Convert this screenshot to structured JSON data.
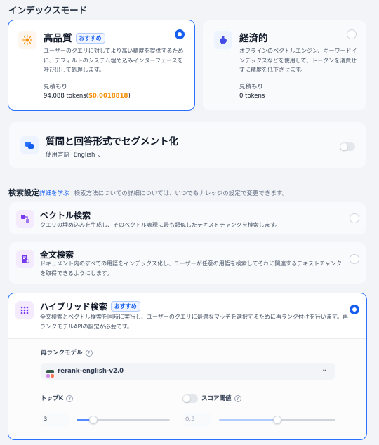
{
  "index_mode": {
    "title": "インデックスモード",
    "high_quality": {
      "title": "高品質",
      "badge": "おすすめ",
      "desc": "ユーザーのクエリに対してより高い精度を提供するために、デフォルトのシステム埋め込みインターフェースを呼び出して処理します。",
      "estimate_label": "見積もり",
      "tokens": "94,088 tokens(",
      "price": "$0.0018818",
      "tokens_close": ")"
    },
    "economy": {
      "title": "経済的",
      "desc": "オフラインのベクトルエンジン、キーワードインデックスなどを使用して、トークンを消費せずに精度を低下させます。",
      "estimate_label": "見積もり",
      "tokens": "0 tokens"
    }
  },
  "qa_segment": {
    "title": "質問と回答形式でセグメント化",
    "lang_label": "使用言語",
    "lang_value": "English"
  },
  "retrieval": {
    "title": "検索設定",
    "learn_more": "詳細を学ぶ",
    "note": "検索方法についての詳細については、いつでもナレッジの設定で変更できます。",
    "vector": {
      "title": "ベクトル検索",
      "desc": "クエリの埋め込みを生成し、そのベクトル表現に最も類似したテキストチャンクを検索します。"
    },
    "fulltext": {
      "title": "全文検索",
      "desc": "ドキュメント内のすべての用語をインデックス化し、ユーザーが任意の用語を検索してそれに関連するテキストチャンクを取得できるようにします。"
    },
    "hybrid": {
      "title": "ハイブリッド検索",
      "badge": "おすすめ",
      "desc": "全文検索とベクトル検索を同時に実行し、ユーザーのクエリに最適なマッチを選択するために再ランク付けを行います。再ランクモデルAPIの設定が必要です。",
      "rerank_label": "再ランクモデル",
      "rerank_model": "rerank-english-v2.0",
      "topk_label": "トップK",
      "topk_value": "3",
      "topk_fraction": 0.18,
      "score_label": "スコア閾値",
      "score_value": "0.5",
      "score_fraction": 0.5
    }
  },
  "colors": {
    "accent": "#155eef",
    "price": "#f79009"
  }
}
